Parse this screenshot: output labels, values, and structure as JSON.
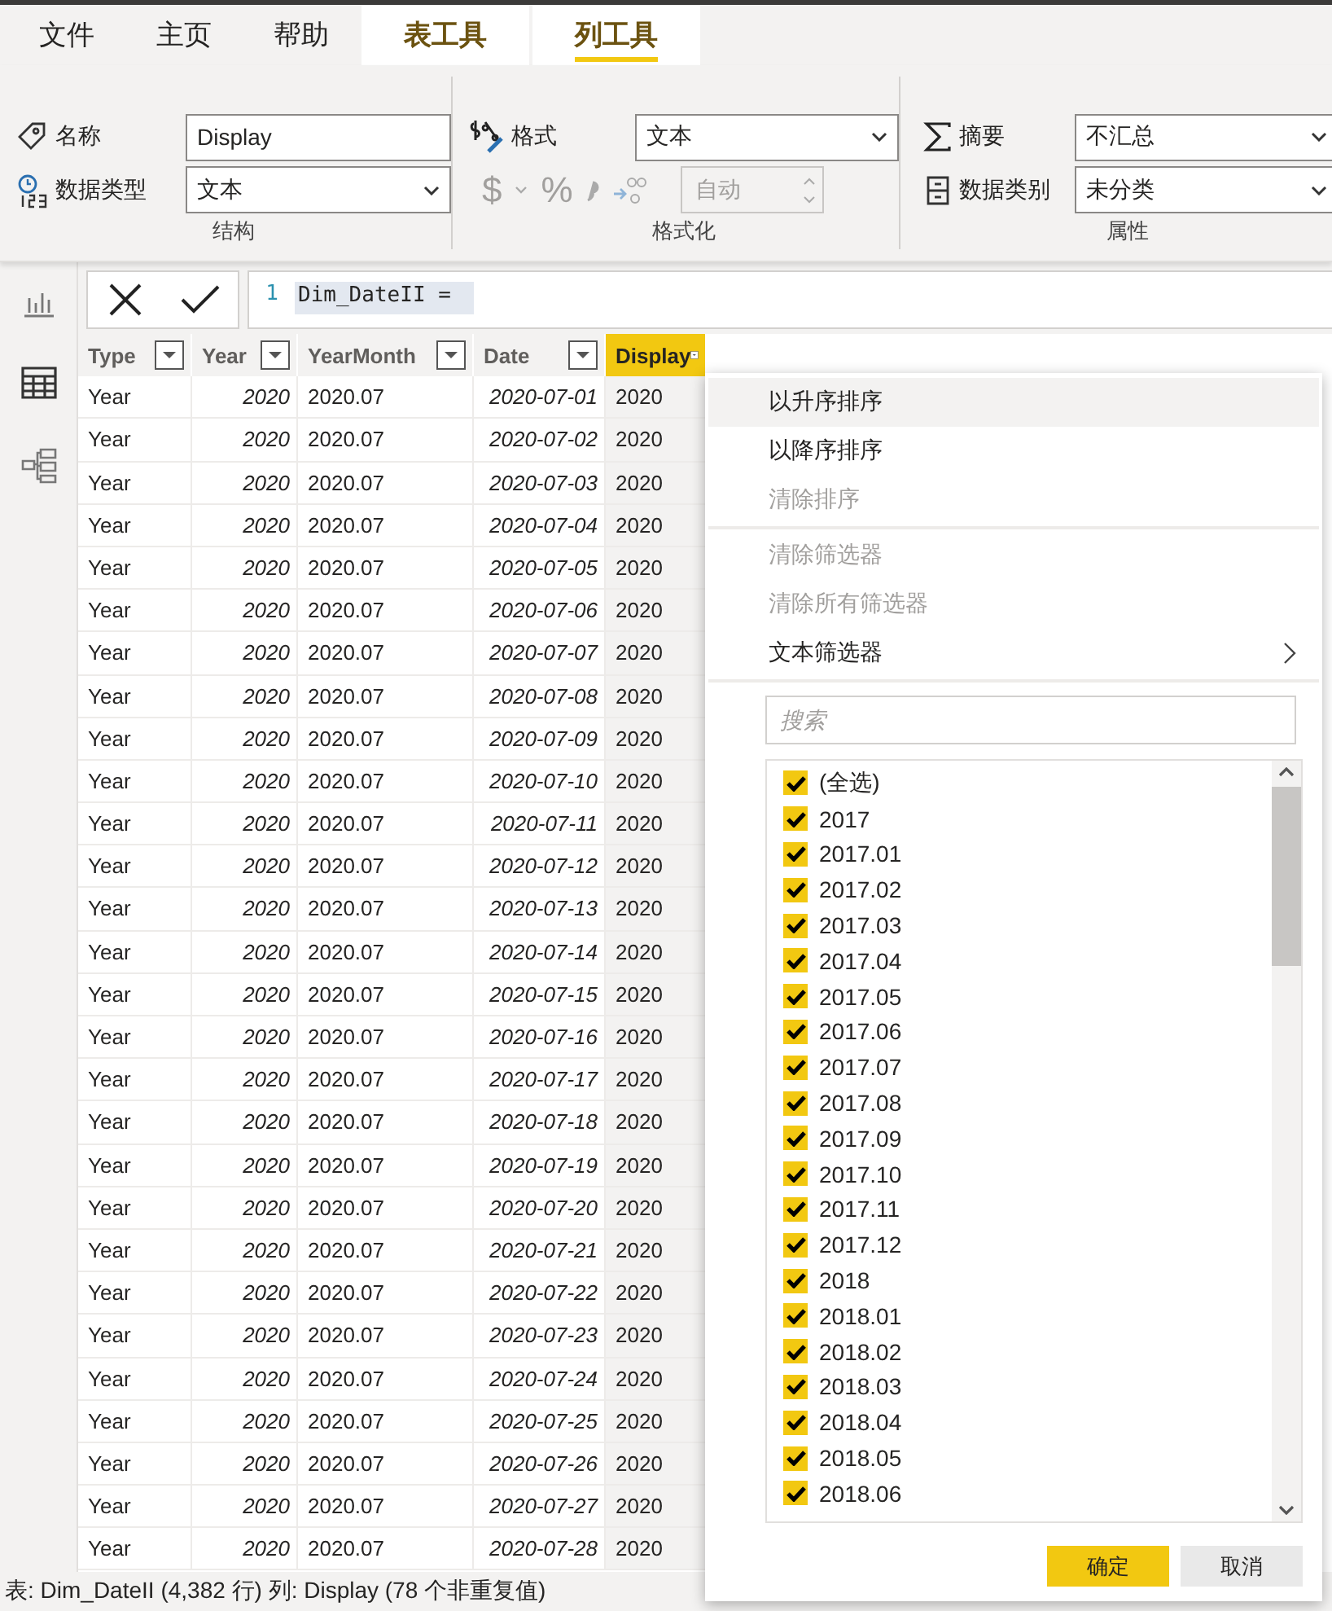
{
  "tabs": [
    {
      "label": "文件",
      "kind": "plain",
      "selected": false
    },
    {
      "label": "主页",
      "kind": "plain",
      "selected": false
    },
    {
      "label": "帮助",
      "kind": "plain",
      "selected": false
    },
    {
      "label": "表工具",
      "kind": "contextual",
      "selected": false
    },
    {
      "label": "列工具",
      "kind": "contextual",
      "selected": true
    }
  ],
  "ribbon": {
    "structure": {
      "name_label": "名称",
      "name_value": "Display",
      "type_label": "数据类型",
      "type_value": "文本",
      "caption": "结构"
    },
    "formatting": {
      "format_label": "格式",
      "format_value": "文本",
      "dollar": "$",
      "percent": "%",
      "decimals_value": "自动",
      "disabled": true,
      "caption": "格式化"
    },
    "properties": {
      "summary_label": "摘要",
      "summary_value": "不汇总",
      "category_label": "数据类别",
      "category_value": "未分类",
      "caption": "属性"
    }
  },
  "formula": {
    "line_number": "1",
    "code": "Dim_DateII ="
  },
  "table": {
    "columns": [
      {
        "name": "Type",
        "active": false
      },
      {
        "name": "Year",
        "active": false
      },
      {
        "name": "YearMonth",
        "active": false
      },
      {
        "name": "Date",
        "active": false
      },
      {
        "name": "Display",
        "active": true
      }
    ],
    "rows": [
      [
        "Year",
        "2020",
        "2020.07",
        "2020-07-01",
        "2020"
      ],
      [
        "Year",
        "2020",
        "2020.07",
        "2020-07-02",
        "2020"
      ],
      [
        "Year",
        "2020",
        "2020.07",
        "2020-07-03",
        "2020"
      ],
      [
        "Year",
        "2020",
        "2020.07",
        "2020-07-04",
        "2020"
      ],
      [
        "Year",
        "2020",
        "2020.07",
        "2020-07-05",
        "2020"
      ],
      [
        "Year",
        "2020",
        "2020.07",
        "2020-07-06",
        "2020"
      ],
      [
        "Year",
        "2020",
        "2020.07",
        "2020-07-07",
        "2020"
      ],
      [
        "Year",
        "2020",
        "2020.07",
        "2020-07-08",
        "2020"
      ],
      [
        "Year",
        "2020",
        "2020.07",
        "2020-07-09",
        "2020"
      ],
      [
        "Year",
        "2020",
        "2020.07",
        "2020-07-10",
        "2020"
      ],
      [
        "Year",
        "2020",
        "2020.07",
        "2020-07-11",
        "2020"
      ],
      [
        "Year",
        "2020",
        "2020.07",
        "2020-07-12",
        "2020"
      ],
      [
        "Year",
        "2020",
        "2020.07",
        "2020-07-13",
        "2020"
      ],
      [
        "Year",
        "2020",
        "2020.07",
        "2020-07-14",
        "2020"
      ],
      [
        "Year",
        "2020",
        "2020.07",
        "2020-07-15",
        "2020"
      ],
      [
        "Year",
        "2020",
        "2020.07",
        "2020-07-16",
        "2020"
      ],
      [
        "Year",
        "2020",
        "2020.07",
        "2020-07-17",
        "2020"
      ],
      [
        "Year",
        "2020",
        "2020.07",
        "2020-07-18",
        "2020"
      ],
      [
        "Year",
        "2020",
        "2020.07",
        "2020-07-19",
        "2020"
      ],
      [
        "Year",
        "2020",
        "2020.07",
        "2020-07-20",
        "2020"
      ],
      [
        "Year",
        "2020",
        "2020.07",
        "2020-07-21",
        "2020"
      ],
      [
        "Year",
        "2020",
        "2020.07",
        "2020-07-22",
        "2020"
      ],
      [
        "Year",
        "2020",
        "2020.07",
        "2020-07-23",
        "2020"
      ],
      [
        "Year",
        "2020",
        "2020.07",
        "2020-07-24",
        "2020"
      ],
      [
        "Year",
        "2020",
        "2020.07",
        "2020-07-25",
        "2020"
      ],
      [
        "Year",
        "2020",
        "2020.07",
        "2020-07-26",
        "2020"
      ],
      [
        "Year",
        "2020",
        "2020.07",
        "2020-07-27",
        "2020"
      ],
      [
        "Year",
        "2020",
        "2020.07",
        "2020-07-28",
        "2020"
      ]
    ]
  },
  "filter_menu": {
    "items": [
      {
        "kind": "item",
        "label": "以升序排序",
        "disabled": false,
        "hovered": true,
        "submenu": false
      },
      {
        "kind": "item",
        "label": "以降序排序",
        "disabled": false,
        "hovered": false,
        "submenu": false
      },
      {
        "kind": "item",
        "label": "清除排序",
        "disabled": true,
        "hovered": false,
        "submenu": false
      },
      {
        "kind": "divider"
      },
      {
        "kind": "item",
        "label": "清除筛选器",
        "disabled": true,
        "hovered": false,
        "submenu": false
      },
      {
        "kind": "item",
        "label": "清除所有筛选器",
        "disabled": true,
        "hovered": false,
        "submenu": false
      },
      {
        "kind": "item",
        "label": "文本筛选器",
        "disabled": false,
        "hovered": false,
        "submenu": true
      },
      {
        "kind": "divider"
      }
    ],
    "search": {
      "placeholder": "搜索"
    },
    "values": [
      {
        "label": "(全选)",
        "checked": true
      },
      {
        "label": "2017",
        "checked": true
      },
      {
        "label": "2017.01",
        "checked": true
      },
      {
        "label": "2017.02",
        "checked": true
      },
      {
        "label": "2017.03",
        "checked": true
      },
      {
        "label": "2017.04",
        "checked": true
      },
      {
        "label": "2017.05",
        "checked": true
      },
      {
        "label": "2017.06",
        "checked": true
      },
      {
        "label": "2017.07",
        "checked": true
      },
      {
        "label": "2017.08",
        "checked": true
      },
      {
        "label": "2017.09",
        "checked": true
      },
      {
        "label": "2017.10",
        "checked": true
      },
      {
        "label": "2017.11",
        "checked": true
      },
      {
        "label": "2017.12",
        "checked": true
      },
      {
        "label": "2018",
        "checked": true
      },
      {
        "label": "2018.01",
        "checked": true
      },
      {
        "label": "2018.02",
        "checked": true
      },
      {
        "label": "2018.03",
        "checked": true
      },
      {
        "label": "2018.04",
        "checked": true
      },
      {
        "label": "2018.05",
        "checked": true
      },
      {
        "label": "2018.06",
        "checked": true
      }
    ],
    "buttons": [
      {
        "label": "确定",
        "kind": "primary"
      },
      {
        "label": "取消",
        "kind": "secondary"
      }
    ]
  },
  "status_bar": "表: Dim_DateII (4,382 行) 列: Display (78 个非重复值)"
}
